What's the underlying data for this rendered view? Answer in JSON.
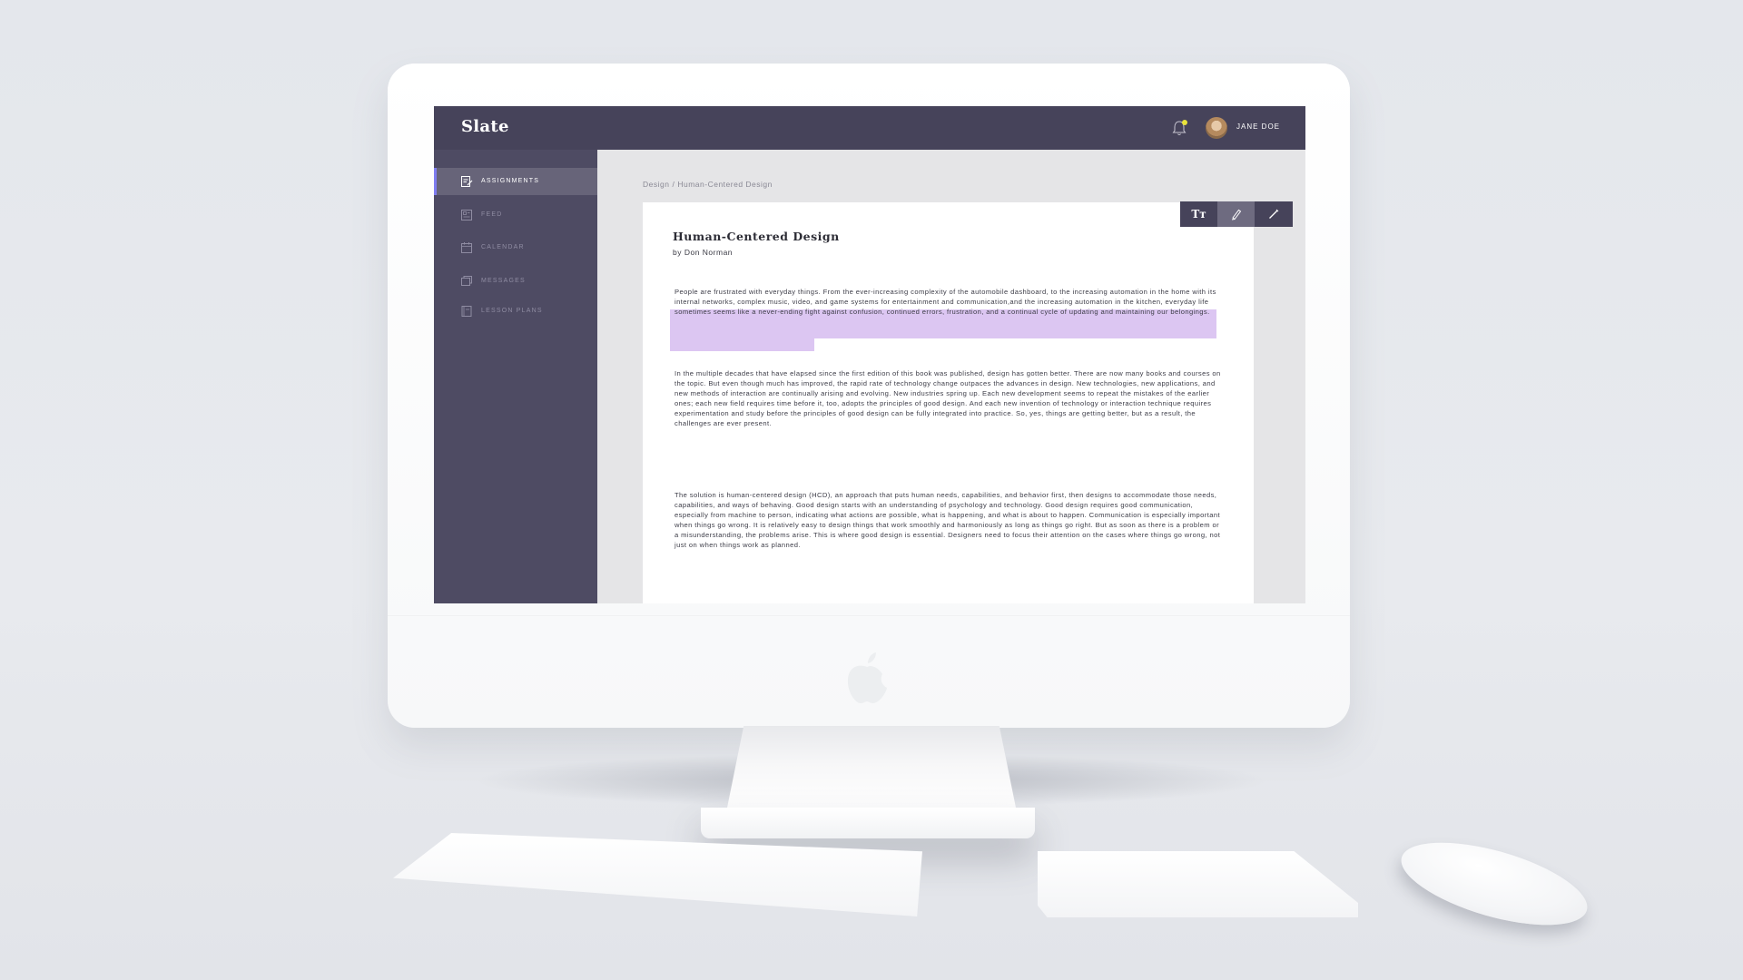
{
  "app": {
    "name": "Slate"
  },
  "header": {
    "user_name": "JANE DOE",
    "notification_dot_color": "#e9e33a"
  },
  "sidebar": {
    "items": [
      {
        "label": "ASSIGNMENTS",
        "icon": "assignments-icon",
        "active": true
      },
      {
        "label": "FEED",
        "icon": "feed-icon",
        "active": false
      },
      {
        "label": "CALENDAR",
        "icon": "calendar-icon",
        "active": false
      },
      {
        "label": "MESSAGES",
        "icon": "messages-icon",
        "active": false
      },
      {
        "label": "LESSON PLANS",
        "icon": "lesson-plans-icon",
        "active": false
      }
    ],
    "accent_color": "#7f7df0"
  },
  "breadcrumb": {
    "items": [
      "Design",
      "Human-Centered Design"
    ],
    "separator": "/"
  },
  "toolbar": {
    "tools": [
      {
        "label": "Tт",
        "icon": "text-size-icon"
      },
      {
        "icon": "highlighter-icon",
        "active": true
      },
      {
        "icon": "pencil-icon"
      }
    ]
  },
  "document": {
    "title": "Human-Centered Design",
    "author": "by Don Norman",
    "highlight_color": "#dcc6f2",
    "paragraphs": [
      "People are frustrated with everyday things. From the ever-increasing complexity of the automobile dashboard, to the increasing automation in the home with its internal networks, complex music, video, and game systems for entertainment and communication,and the increasing automation in the kitchen, everyday life sometimes seems like a never-ending fight against confusion, continued errors, frustration, and a continual cycle of updating and maintaining our belongings.",
      "In the multiple decades that have elapsed since the first edition of this book was published, design has gotten better. There are now many books and courses on the topic. But even though much has improved, the rapid rate of technology change outpaces the advances in design. New technologies, new applications, and new methods of interaction are continually arising and evolving. New industries spring up. Each new development seems to repeat the mistakes of the earlier ones; each new field requires time before it, too, adopts the principles of good design. And each new invention of technology or interaction technique requires experimentation and study before the principles of good design can be fully integrated into practice. So, yes, things are getting better, but as a result, the challenges are ever present.",
      "The solution is human-centered design (HCD), an approach that puts human needs, capabilities, and behavior first, then designs to accommodate those needs, capabilities, and ways of behaving. Good design starts with an understanding of psychology and technology. Good design requires good communication, especially from machine to person, indicating what actions are possible, what is happening, and what is about to happen. Communication is especially important when things go wrong. It is relatively easy to design things that work smoothly and harmoniously as long as things go right. But as soon as there is a problem or a misunderstanding, the problems arise. This is where good design is essential. Designers need to focus their attention on the cases where things go wrong, not just on when things work as planned."
    ]
  }
}
